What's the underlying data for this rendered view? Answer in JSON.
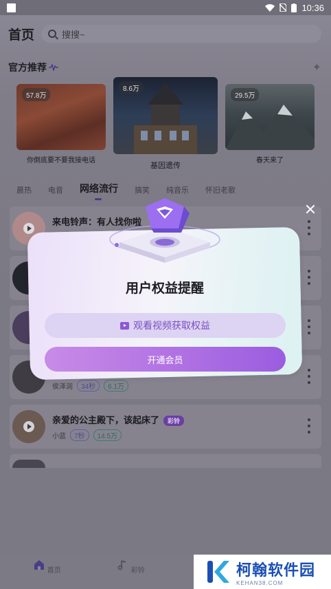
{
  "status": {
    "time": "10:36"
  },
  "header": {
    "title": "首页",
    "search_placeholder": "搜搜~"
  },
  "section": {
    "title": "官方推荐"
  },
  "cards": [
    {
      "count": "57.8万",
      "label": "你倒底要不要我接电话"
    },
    {
      "count": "8.6万",
      "label": "基因遗传"
    },
    {
      "count": "29.5万",
      "label": "春天来了"
    }
  ],
  "tabs": [
    "晨热",
    "电音",
    "网络流行",
    "搞笑",
    "纯音乐",
    "怀旧老歌"
  ],
  "tabs_active": "网络流行",
  "list": [
    {
      "name": "来电铃声：有人找你啦",
      "artist": "",
      "duration": "",
      "plays": ""
    },
    {
      "name": "",
      "artist": "",
      "duration": "",
      "plays": ""
    },
    {
      "name": "",
      "artist": "",
      "duration": "",
      "plays": ""
    },
    {
      "name": "",
      "artist": "侯泽润",
      "duration": "34秒",
      "plays": "6.1万"
    },
    {
      "name": "亲爱的公主殿下，该起床了",
      "badge": "彩铃",
      "artist": "小蓝",
      "duration": "7秒",
      "plays": "14.5万"
    }
  ],
  "modal": {
    "title": "用户权益提醒",
    "watch_label": "观看视频获取权益",
    "vip_label": "开通会员"
  },
  "nav": {
    "home": "首页",
    "ringtone": "彩铃"
  },
  "watermark": {
    "name": "柯翰软件园",
    "domain": "KEHAN38.COM"
  }
}
